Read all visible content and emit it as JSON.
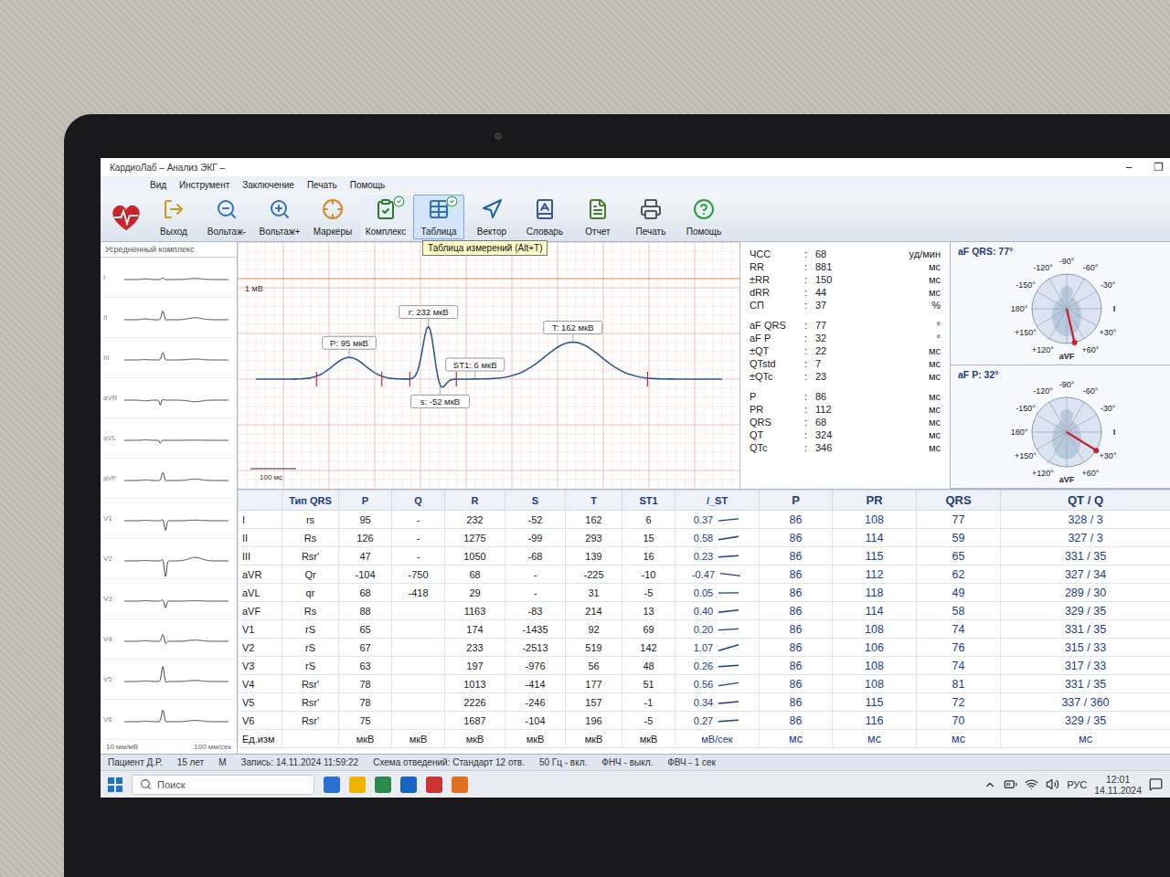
{
  "window": {
    "title": "КардиоЛаб – Анализ ЭКГ –",
    "controls": [
      "–",
      "❐"
    ]
  },
  "menu": [
    "Вид",
    "Инструмент",
    "Заключение",
    "Печать",
    "Помощь"
  ],
  "toolbar": [
    {
      "label": "Выход",
      "active": false,
      "hover": false
    },
    {
      "label": "Вольтаж-",
      "active": false,
      "hover": false
    },
    {
      "label": "Вольтаж+",
      "active": false,
      "hover": false
    },
    {
      "label": "Маркеры",
      "active": false,
      "hover": false
    },
    {
      "label": "Комплекс",
      "active": true,
      "hover": false
    },
    {
      "label": "Таблица",
      "active": true,
      "hover": true
    },
    {
      "label": "Вектор",
      "active": false,
      "hover": false
    },
    {
      "label": "Словарь",
      "active": false,
      "hover": false
    },
    {
      "label": "Отчет",
      "active": false,
      "hover": false
    },
    {
      "label": "Печать",
      "active": false,
      "hover": false
    },
    {
      "label": "Помощь",
      "active": false,
      "hover": false
    }
  ],
  "tooltip": "Таблица измерений (Alt+T)",
  "leads_panel": {
    "title": "Усредненный комплекс",
    "scale": "10 мм/мВ",
    "speed": "100 мм/сек"
  },
  "plot": {
    "lead": "I",
    "amplitude_scale": "1 мВ",
    "time_scale": "100 мс",
    "markers": [
      {
        "label": "P: 95 мкВ",
        "kind": "P"
      },
      {
        "label": "r: 232 мкВ",
        "kind": "R"
      },
      {
        "label": "s: -52 мкВ",
        "kind": "S"
      },
      {
        "label": "ST1: 6 мкВ",
        "kind": "ST"
      },
      {
        "label": "T: 162 мкВ",
        "kind": "T"
      }
    ]
  },
  "params": [
    [
      {
        "label": "ЧСС",
        "value": "68",
        "unit": "уд/мин"
      },
      {
        "label": "RR",
        "value": "881",
        "unit": "мс"
      },
      {
        "label": "±RR",
        "value": "150",
        "unit": "мс"
      },
      {
        "label": "dRR",
        "value": "44",
        "unit": "мс"
      },
      {
        "label": "СП",
        "value": "37",
        "unit": "%"
      }
    ],
    [
      {
        "label": "aF QRS",
        "value": "77",
        "unit": "°"
      },
      {
        "label": "aF P",
        "value": "32",
        "unit": "°"
      },
      {
        "label": "±QT",
        "value": "22",
        "unit": "мс"
      },
      {
        "label": "QTstd",
        "value": "7",
        "unit": "мс"
      },
      {
        "label": "±QTc",
        "value": "23",
        "unit": "мс"
      }
    ],
    [
      {
        "label": "P",
        "value": "86",
        "unit": "мс"
      },
      {
        "label": "PR",
        "value": "112",
        "unit": "мс"
      },
      {
        "label": "QRS",
        "value": "68",
        "unit": "мс"
      },
      {
        "label": "QT",
        "value": "324",
        "unit": "мс"
      },
      {
        "label": "QTc",
        "value": "346",
        "unit": "мс"
      }
    ]
  ],
  "vectors": [
    {
      "title": "aF QRS: 77°",
      "angle": 77,
      "labels": [
        "-120°",
        "-90°",
        "-60°",
        "-150°",
        "-30°",
        "180°",
        "I",
        "+150°",
        "+30°",
        "+120°",
        "+60°",
        "aVF"
      ]
    },
    {
      "title": "aF P: 32°",
      "angle": 32,
      "labels": [
        "-120°",
        "-90°",
        "-60°",
        "-150°",
        "-30°",
        "180°",
        "I",
        "+150°",
        "+30°",
        "+120°",
        "+60°",
        "aVF"
      ]
    }
  ],
  "table": {
    "columns": [
      "",
      "Тип QRS",
      "P",
      "Q",
      "R",
      "S",
      "T",
      "ST1",
      "/_ST",
      "P",
      "PR",
      "QRS",
      "QT / Q"
    ],
    "rows": [
      [
        "I",
        "rs",
        "95",
        "-",
        "232",
        "-52",
        "162",
        "6",
        "0.37",
        "86",
        "108",
        "77",
        "328 / 3"
      ],
      [
        "II",
        "Rs",
        "126",
        "-",
        "1275",
        "-99",
        "293",
        "15",
        "0.58",
        "86",
        "114",
        "59",
        "327 / 3"
      ],
      [
        "III",
        "Rsr'",
        "47",
        "-",
        "1050",
        "-68",
        "139",
        "16",
        "0.23",
        "86",
        "115",
        "65",
        "331 / 35"
      ],
      [
        "aVR",
        "Qr",
        "-104",
        "-750",
        "68",
        "-",
        "-225",
        "-10",
        "-0.47",
        "86",
        "112",
        "62",
        "327 / 34"
      ],
      [
        "aVL",
        "qr",
        "68",
        "-418",
        "29",
        "-",
        "31",
        "-5",
        "0.05",
        "86",
        "118",
        "49",
        "289 / 30"
      ],
      [
        "aVF",
        "Rs",
        "88",
        "",
        "1163",
        "-83",
        "214",
        "13",
        "0.40",
        "86",
        "114",
        "58",
        "329 / 35"
      ],
      [
        "V1",
        "rS",
        "65",
        "",
        "174",
        "-1435",
        "92",
        "69",
        "0.20",
        "86",
        "108",
        "74",
        "331 / 35"
      ],
      [
        "V2",
        "rS",
        "67",
        "",
        "233",
        "-2513",
        "519",
        "142",
        "1.07",
        "86",
        "106",
        "76",
        "315 / 33"
      ],
      [
        "V3",
        "rS",
        "63",
        "",
        "197",
        "-976",
        "56",
        "48",
        "0.26",
        "86",
        "108",
        "74",
        "317 / 33"
      ],
      [
        "V4",
        "Rsr'",
        "78",
        "",
        "1013",
        "-414",
        "177",
        "51",
        "0.56",
        "86",
        "108",
        "81",
        "331 / 35"
      ],
      [
        "V5",
        "Rsr'",
        "78",
        "",
        "2226",
        "-246",
        "157",
        "-1",
        "0.34",
        "86",
        "115",
        "72",
        "337 / 360"
      ],
      [
        "V6",
        "Rsr'",
        "75",
        "",
        "1687",
        "-104",
        "196",
        "-5",
        "0.27",
        "86",
        "116",
        "70",
        "329 / 35"
      ]
    ],
    "units": [
      "Ед.изм",
      "",
      "мкВ",
      "мкВ",
      "мкВ",
      "мкВ",
      "мкВ",
      "мкВ",
      "мВ/сек",
      "мс",
      "мс",
      "мс",
      "мс"
    ]
  },
  "status_bar": [
    "Пациент Д.Р.",
    "15 лет",
    "М",
    "Запись: 14.11.2024 11:59:22",
    "Схема отведений: Стандарт 12 отв.",
    "50 Гц - вкл.",
    "ФНЧ - выкл.",
    "ФВЧ - 1 сек"
  ],
  "taskbar": {
    "search": "Поиск",
    "language": "РУС",
    "time": "12:01",
    "date": "14.11.2024"
  }
}
